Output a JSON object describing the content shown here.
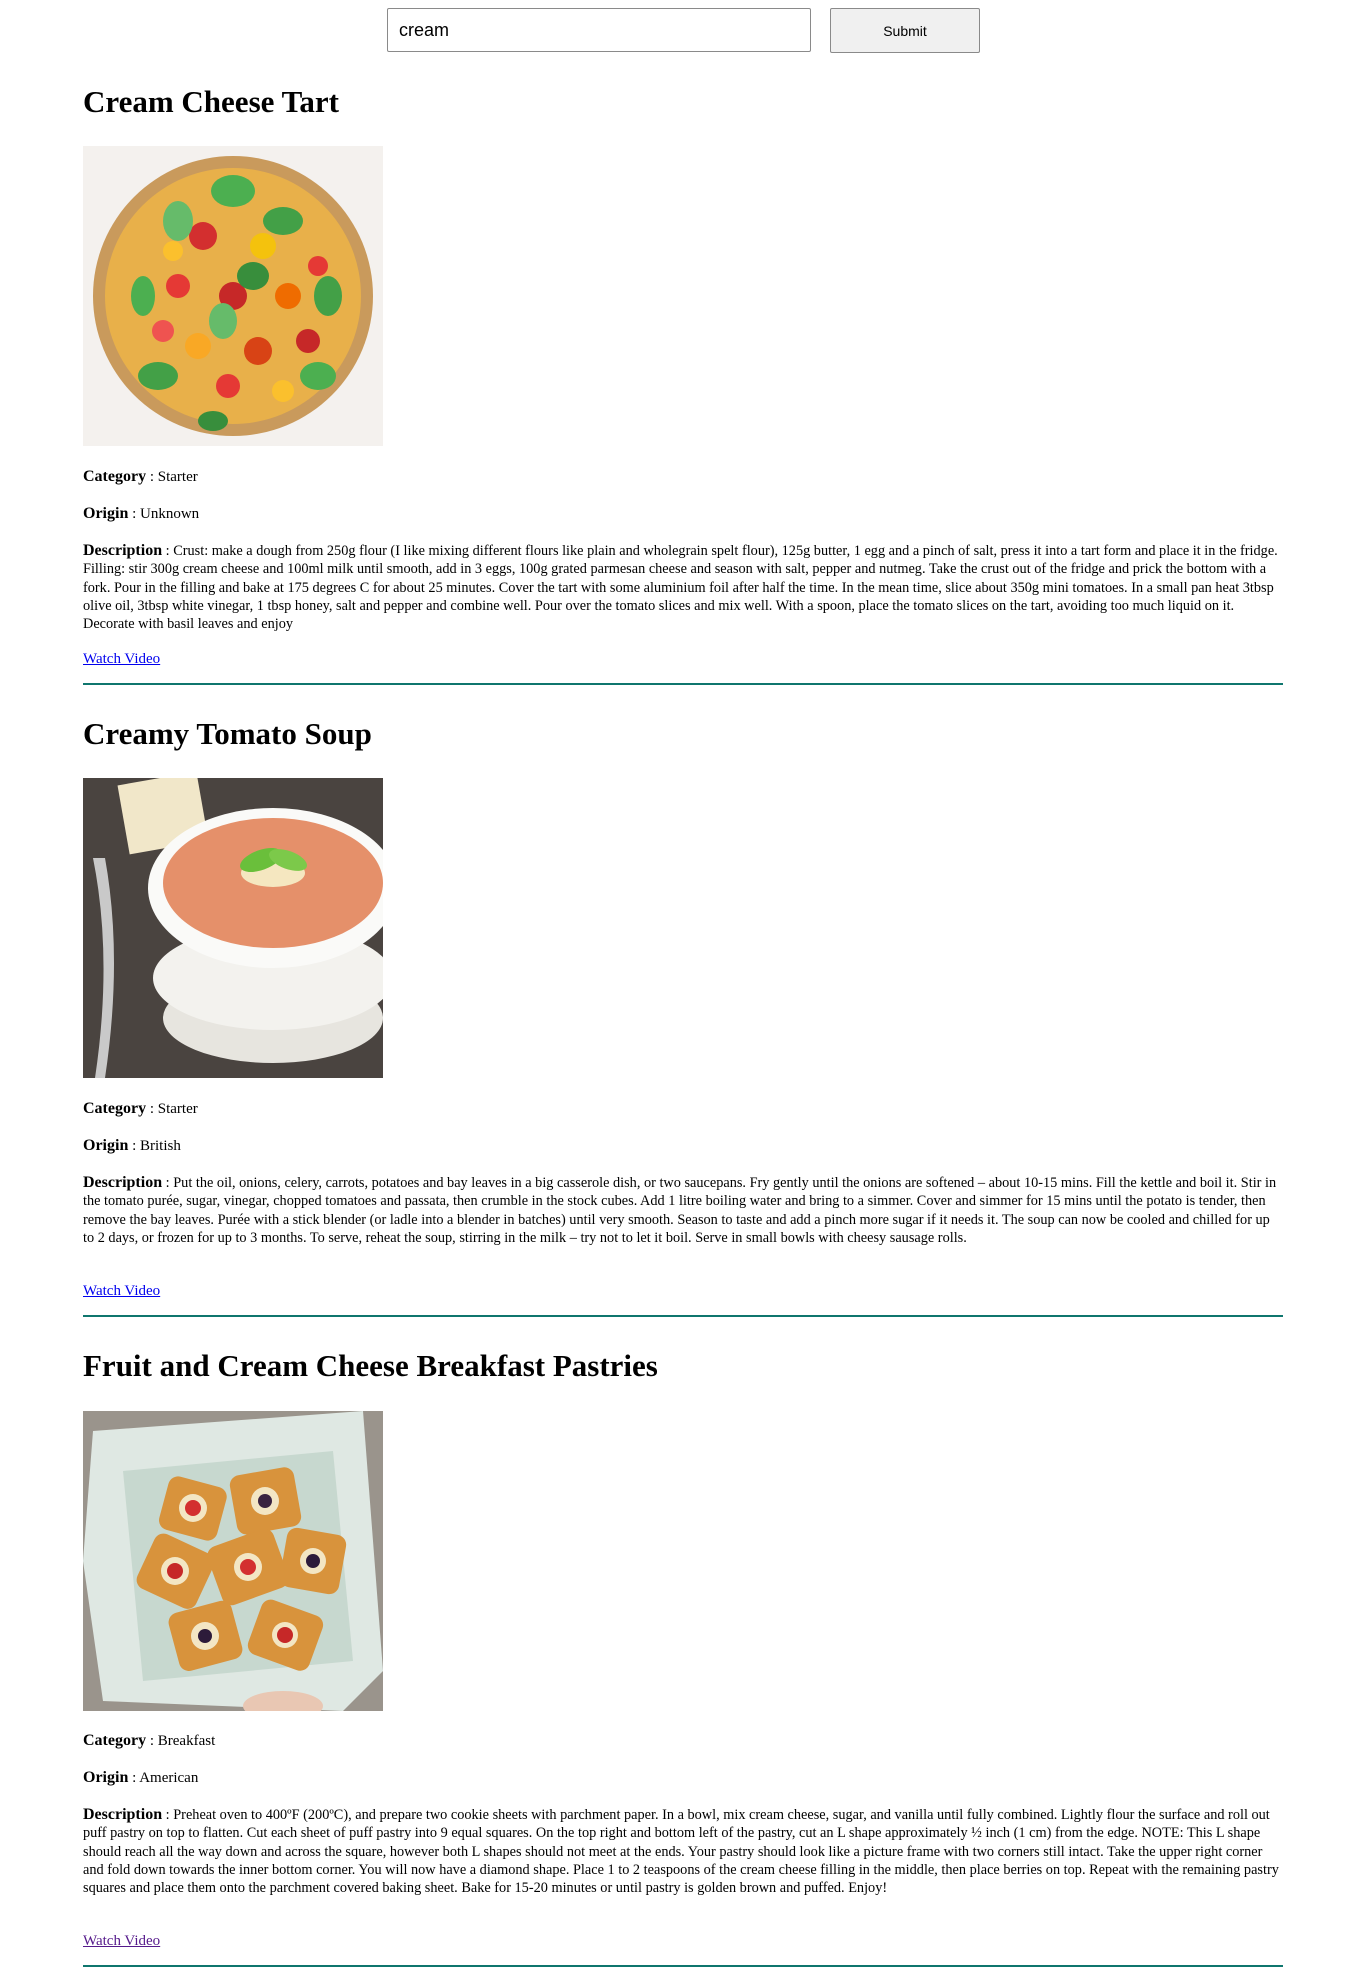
{
  "search": {
    "value": "cream",
    "submit_label": "Submit"
  },
  "labels": {
    "category": "Category",
    "origin": "Origin",
    "description": "Description",
    "separator": " : "
  },
  "recipes": [
    {
      "title": "Cream Cheese Tart",
      "category": "Starter",
      "origin": "Unknown",
      "description": "Crust: make a dough from 250g flour (I like mixing different flours like plain and wholegrain spelt flour), 125g butter, 1 egg and a pinch of salt, press it into a tart form and place it in the fridge. Filling: stir 300g cream cheese and 100ml milk until smooth, add in 3 eggs, 100g grated parmesan cheese and season with salt, pepper and nutmeg. Take the crust out of the fridge and prick the bottom with a fork. Pour in the filling and bake at 175 degrees C for about 25 minutes. Cover the tart with some aluminium foil after half the time. In the mean time, slice about 350g mini tomatoes. In a small pan heat 3tbsp olive oil, 3tbsp white vinegar, 1 tbsp honey, salt and pepper and combine well. Pour over the tomato slices and mix well. With a spoon, place the tomato slices on the tart, avoiding too much liquid on it. Decorate with basil leaves and enjoy",
      "video_label": "Watch Video"
    },
    {
      "title": "Creamy Tomato Soup",
      "category": "Starter",
      "origin": "British",
      "description": "Put the oil, onions, celery, carrots, potatoes and bay leaves in a big casserole dish, or two saucepans. Fry gently until the onions are softened – about 10-15 mins. Fill the kettle and boil it. Stir in the tomato purée, sugar, vinegar, chopped tomatoes and passata, then crumble in the stock cubes. Add 1 litre boiling water and bring to a simmer. Cover and simmer for 15 mins until the potato is tender, then remove the bay leaves. Purée with a stick blender (or ladle into a blender in batches) until very smooth. Season to taste and add a pinch more sugar if it needs it. The soup can now be cooled and chilled for up to 2 days, or frozen for up to 3 months. To serve, reheat the soup, stirring in the milk – try not to let it boil. Serve in small bowls with cheesy sausage rolls.",
      "video_label": "Watch Video"
    },
    {
      "title": "Fruit and Cream Cheese Breakfast Pastries",
      "category": "Breakfast",
      "origin": "American",
      "description": "Preheat oven to 400ºF (200ºC), and prepare two cookie sheets with parchment paper. In a bowl, mix cream cheese, sugar, and vanilla until fully combined. Lightly flour the surface and roll out puff pastry on top to flatten. Cut each sheet of puff pastry into 9 equal squares. On the top right and bottom left of the pastry, cut an L shape approximately ½ inch (1 cm) from the edge. NOTE: This L shape should reach all the way down and across the square, however both L shapes should not meet at the ends. Your pastry should look like a picture frame with two corners still intact. Take the upper right corner and fold down towards the inner bottom corner. You will now have a diamond shape. Place 1 to 2 teaspoons of the cream cheese filling in the middle, then place berries on top. Repeat with the remaining pastry squares and place them onto the parchment covered baking sheet. Bake for 15-20 minutes or until pastry is golden brown and puffed. Enjoy!",
      "video_label": "Watch Video"
    }
  ]
}
